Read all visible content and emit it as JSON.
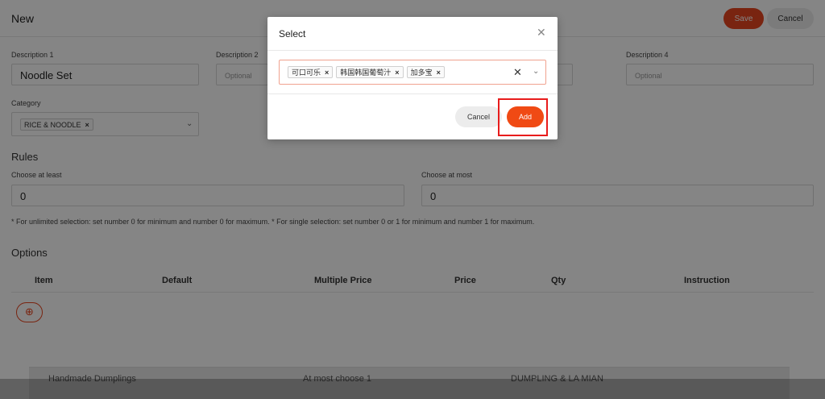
{
  "header": {
    "title": "New",
    "save_label": "Save",
    "cancel_label": "Cancel"
  },
  "form": {
    "description1": {
      "label": "Description 1",
      "value": "Noodle Set"
    },
    "description2": {
      "label": "Description 2",
      "placeholder": "Optional"
    },
    "description4": {
      "label": "Description 4",
      "placeholder": "Optional"
    },
    "category": {
      "label": "Category",
      "selected": "RICE & NOODLE"
    }
  },
  "rules": {
    "title": "Rules",
    "min_label": "Choose at least",
    "min_value": "0",
    "max_label": "Choose at most",
    "max_value": "0",
    "note": "* For unlimited selection: set number 0 for minimum and number 0 for maximum. * For single selection: set number 0 or 1 for minimum and number 1 for maximum."
  },
  "options": {
    "title": "Options",
    "columns": [
      "Item",
      "Default",
      "Multiple Price",
      "Price",
      "Qty",
      "Instruction"
    ]
  },
  "background_list": [
    "Handmade Dumplings",
    "At most choose 1",
    "DUMPLING & LA MIAN"
  ],
  "modal": {
    "title": "Select",
    "chips": [
      "可口可乐",
      "韩国韩国葡萄汁",
      "加多宝"
    ],
    "cancel_label": "Cancel",
    "add_label": "Add"
  },
  "colors": {
    "accent": "#f04a14",
    "highlight": "#e81c1c"
  }
}
